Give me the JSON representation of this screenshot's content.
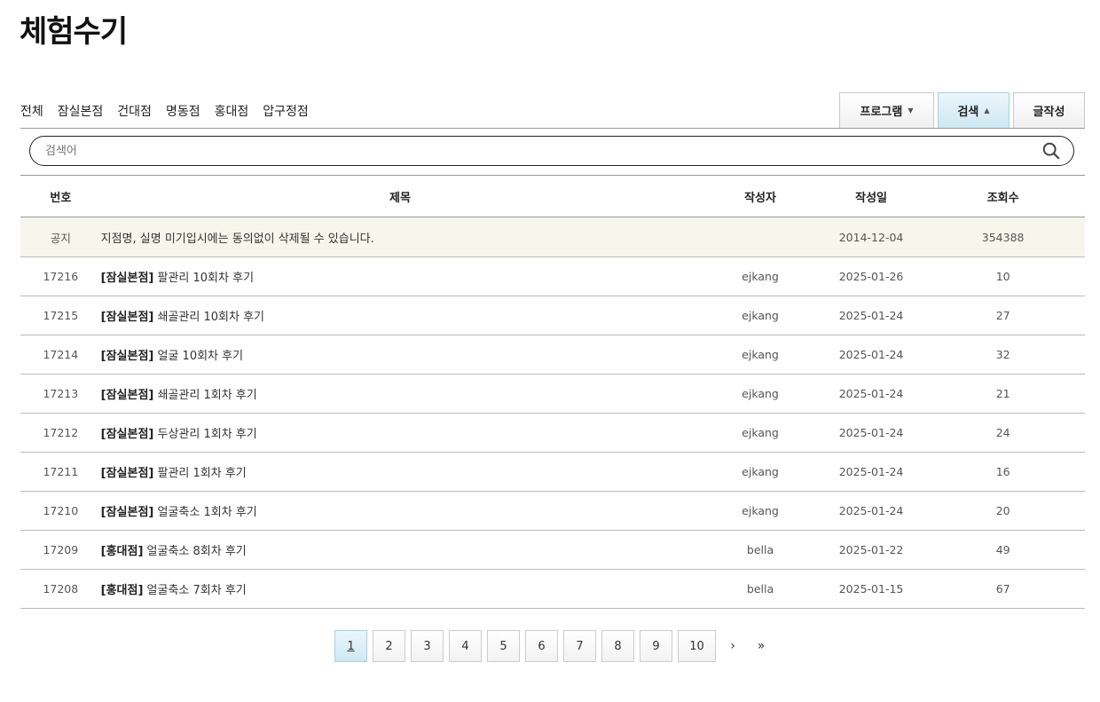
{
  "page_title": "체험수기",
  "categories": [
    "전체",
    "잠실본점",
    "건대점",
    "명동점",
    "홍대점",
    "압구정점"
  ],
  "buttons": {
    "program": "프로그램",
    "search": "검색",
    "write": "글작성"
  },
  "search": {
    "placeholder": "검색어"
  },
  "table": {
    "headers": {
      "no": "번호",
      "title": "제목",
      "author": "작성자",
      "date": "작성일",
      "views": "조회수"
    },
    "notice": {
      "no": "공지",
      "title": "지점명, 실명 미기입시에는 동의없이 삭제될 수 있습니다.",
      "author": "",
      "date": "2014-12-04",
      "views": "354388"
    },
    "rows": [
      {
        "no": "17216",
        "branch": "[잠실본점]",
        "title": " 팔관리 10회차 후기",
        "author": "ejkang",
        "date": "2025-01-26",
        "views": "10"
      },
      {
        "no": "17215",
        "branch": "[잠실본점]",
        "title": " 쇄골관리 10회차 후기",
        "author": "ejkang",
        "date": "2025-01-24",
        "views": "27"
      },
      {
        "no": "17214",
        "branch": "[잠실본점]",
        "title": " 얼굴 10회차 후기",
        "author": "ejkang",
        "date": "2025-01-24",
        "views": "32"
      },
      {
        "no": "17213",
        "branch": "[잠실본점]",
        "title": " 쇄골관리 1회차 후기",
        "author": "ejkang",
        "date": "2025-01-24",
        "views": "21"
      },
      {
        "no": "17212",
        "branch": "[잠실본점]",
        "title": " 두상관리 1회차 후기",
        "author": "ejkang",
        "date": "2025-01-24",
        "views": "24"
      },
      {
        "no": "17211",
        "branch": "[잠실본점]",
        "title": " 팔관리 1회차 후기",
        "author": "ejkang",
        "date": "2025-01-24",
        "views": "16"
      },
      {
        "no": "17210",
        "branch": "[잠실본점]",
        "title": " 얼굴축소 1회차 후기",
        "author": "ejkang",
        "date": "2025-01-24",
        "views": "20"
      },
      {
        "no": "17209",
        "branch": "[홍대점]",
        "title": " 얼굴축소 8회차 후기",
        "author": "bella",
        "date": "2025-01-22",
        "views": "49"
      },
      {
        "no": "17208",
        "branch": "[홍대점]",
        "title": " 얼굴축소 7회차 후기",
        "author": "bella",
        "date": "2025-01-15",
        "views": "67"
      }
    ]
  },
  "pagination": {
    "pages": [
      "1",
      "2",
      "3",
      "4",
      "5",
      "6",
      "7",
      "8",
      "9",
      "10"
    ],
    "current": "1",
    "next": "›",
    "last": "»"
  },
  "icons": {
    "search": "search-icon",
    "dropdown": "caret-down-icon",
    "dropup": "caret-up-icon"
  }
}
